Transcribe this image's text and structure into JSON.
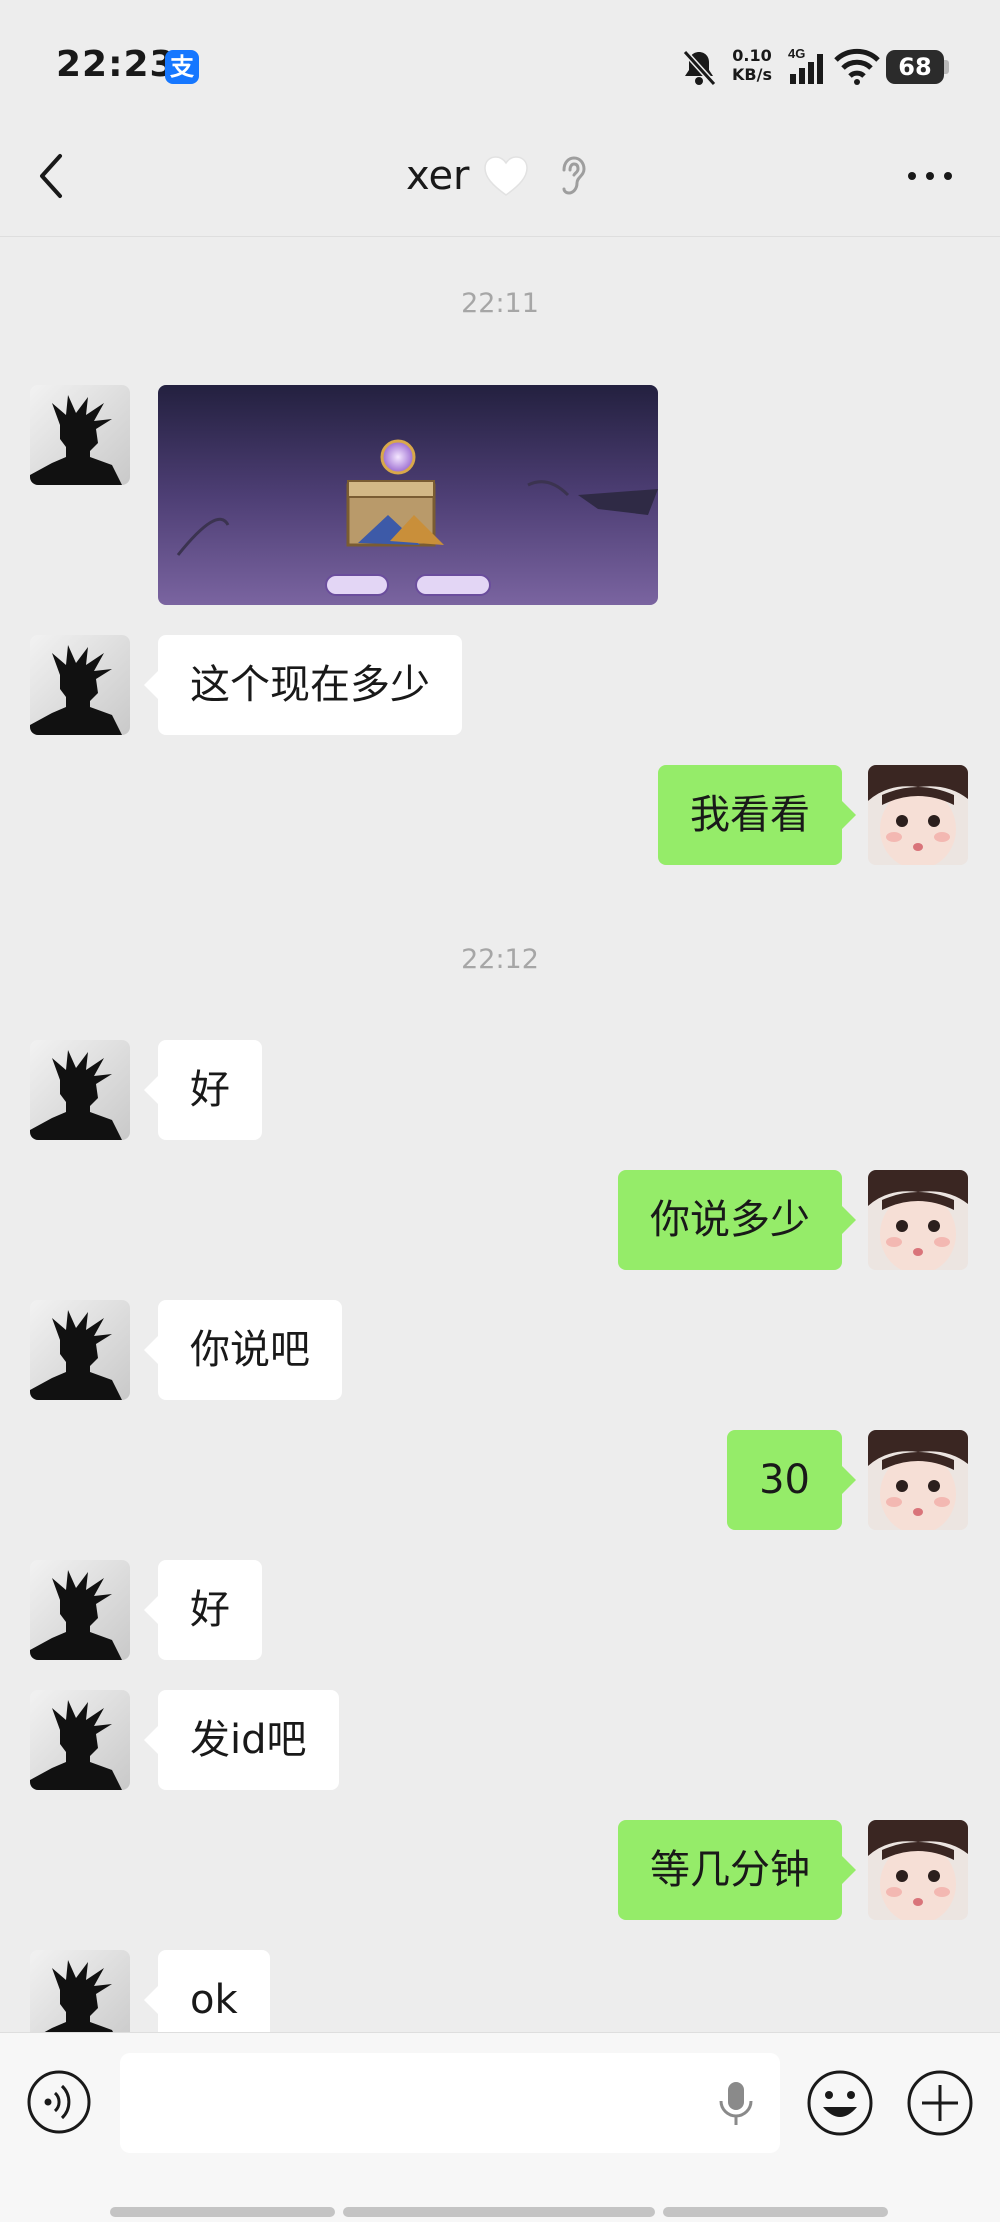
{
  "status_bar": {
    "time": "22:23",
    "alipay_glyph": "支",
    "net_speed_value": "0.10",
    "net_speed_unit": "KB/s",
    "network_type": "4G",
    "battery": "68",
    "icons": [
      "alipay-icon",
      "bell-off-icon",
      "signal-icon",
      "wifi-icon",
      "battery-icon"
    ]
  },
  "header": {
    "title": "xer",
    "icons": [
      "back-icon",
      "white-heart-icon",
      "ear-icon",
      "more-icon"
    ]
  },
  "messages": [
    {
      "type": "time",
      "text": "22:11"
    },
    {
      "type": "image",
      "sender": "other"
    },
    {
      "type": "text",
      "sender": "other",
      "text": "这个现在多少"
    },
    {
      "type": "text",
      "sender": "me",
      "text": "我看看"
    },
    {
      "type": "time",
      "text": "22:12"
    },
    {
      "type": "text",
      "sender": "other",
      "text": "好"
    },
    {
      "type": "text",
      "sender": "me",
      "text": "你说多少"
    },
    {
      "type": "text",
      "sender": "other",
      "text": "你说吧"
    },
    {
      "type": "text",
      "sender": "me",
      "text": "30"
    },
    {
      "type": "text",
      "sender": "other",
      "text": "好"
    },
    {
      "type": "text",
      "sender": "other",
      "text": "发id吧"
    },
    {
      "type": "text",
      "sender": "me",
      "text": "等几分钟"
    },
    {
      "type": "text",
      "sender": "other",
      "text": "ok"
    }
  ],
  "colors": {
    "background": "#ededed",
    "my_bubble": "#95ec69",
    "other_bubble": "#ffffff",
    "timestamp": "#a6a6a6"
  },
  "input_bar": {
    "message_value": "",
    "icons": [
      "voice-icon",
      "mic-icon",
      "emoji-icon",
      "plus-icon"
    ]
  }
}
